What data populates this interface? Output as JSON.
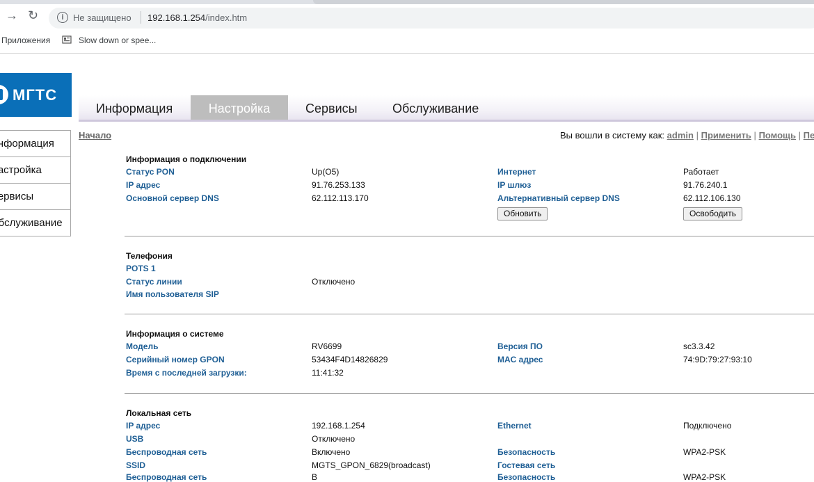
{
  "browser": {
    "security_label": "Не защищено",
    "url_host": "192.168.1.254",
    "url_path": "/index.htm",
    "bookmarks": [
      "Приложения",
      "Slow down or spee..."
    ]
  },
  "brand": {
    "logo_text": "МГТС",
    "color": "#0a6fb8"
  },
  "topnav": {
    "items": [
      "Информация",
      "Настройка",
      "Сервисы",
      "Обслуживание"
    ],
    "active": "Настройка"
  },
  "sidebar": {
    "items": [
      "Информация",
      "Настройка",
      "Сервисы",
      "Обслуживание"
    ]
  },
  "breadcrumb": "Начало",
  "login": {
    "prefix": "Вы вошли в систему как:",
    "user": "admin",
    "links": [
      "Применить",
      "Помощь",
      "Пе"
    ]
  },
  "connection": {
    "title": "Информация о подключении",
    "pon_status_label": "Статус PON",
    "pon_status": "Up(O5)",
    "internet_label": "Интернет",
    "internet": "Работает",
    "ip_label": "IP адрес",
    "ip": "91.76.253.133",
    "gateway_label": "IP шлюз",
    "gateway": "91.76.240.1",
    "dns_label": "Основной сервер DNS",
    "dns": "62.112.113.170",
    "alt_dns_label": "Альтернативный сервер DNS",
    "alt_dns": "62.112.106.130",
    "renew_button": "Обновить",
    "release_button": "Освободить"
  },
  "telephony": {
    "title": "Телефония",
    "pots_label": "POTS 1",
    "line_status_label": "Статус линии",
    "line_status": "Отключено",
    "sip_user_label": "Имя пользователя SIP"
  },
  "system": {
    "title": "Информация о системе",
    "model_label": "Модель",
    "model": "RV6699",
    "fw_label": "Версия ПО",
    "fw": "sc3.3.42",
    "serial_label": "Серийный номер GPON",
    "serial": "53434F4D14826829",
    "mac_label": "MAC адрес",
    "mac": "74:9D:79:27:93:10",
    "uptime_label": "Время с последней загрузки:",
    "uptime": "11:41:32"
  },
  "lan": {
    "title": "Локальная сеть",
    "ip_label": "IP адрес",
    "ip": "192.168.1.254",
    "ethernet_label": "Ethernet",
    "ethernet": "Подключено",
    "usb_label": "USB",
    "usb": "Отключено",
    "wifi_label": "Беспроводная сеть",
    "wifi": "Включено",
    "security_label": "Безопасность",
    "security": "WPA2-PSK",
    "ssid_label": "SSID",
    "ssid": "MGTS_GPON_6829(broadcast)",
    "guest_label": "Гостевая сеть",
    "wifi2_label": "Беспроводная сеть",
    "wifi2": "В",
    "security2_label": "Безопасность",
    "security2": "WPA2-PSK"
  }
}
